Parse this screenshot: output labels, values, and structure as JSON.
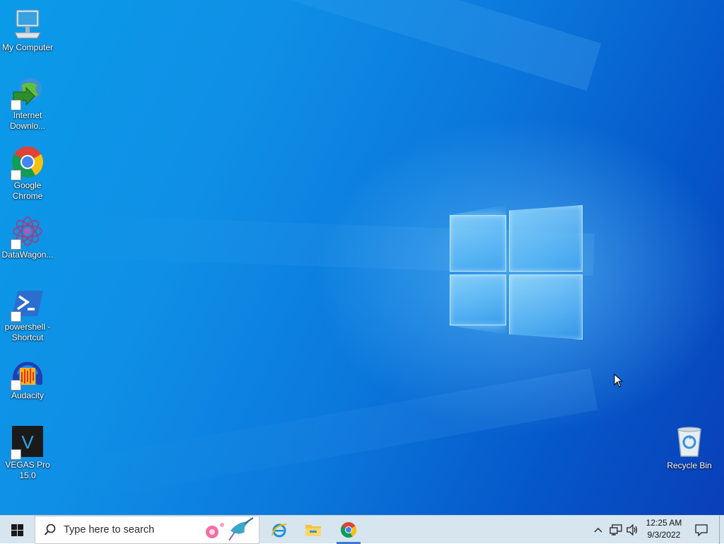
{
  "desktop": {
    "icons": [
      {
        "label": "My Computer"
      },
      {
        "label": "Internet Downlo..."
      },
      {
        "label": "Google Chrome"
      },
      {
        "label": "DataWagon..."
      },
      {
        "label": "powershell - Shortcut"
      },
      {
        "label": "Audacity"
      },
      {
        "label": "VEGAS Pro 15.0"
      },
      {
        "label": "Recycle Bin"
      }
    ]
  },
  "taskbar": {
    "search_placeholder": "Type here to search",
    "pinned": [
      "internet-explorer-icon",
      "file-explorer-icon",
      "chrome-icon"
    ],
    "clock": {
      "time": "12:25 AM",
      "date": "9/3/2022"
    }
  },
  "colors": {
    "accent": "#0078d7",
    "taskbar": "#d7e5ef"
  }
}
